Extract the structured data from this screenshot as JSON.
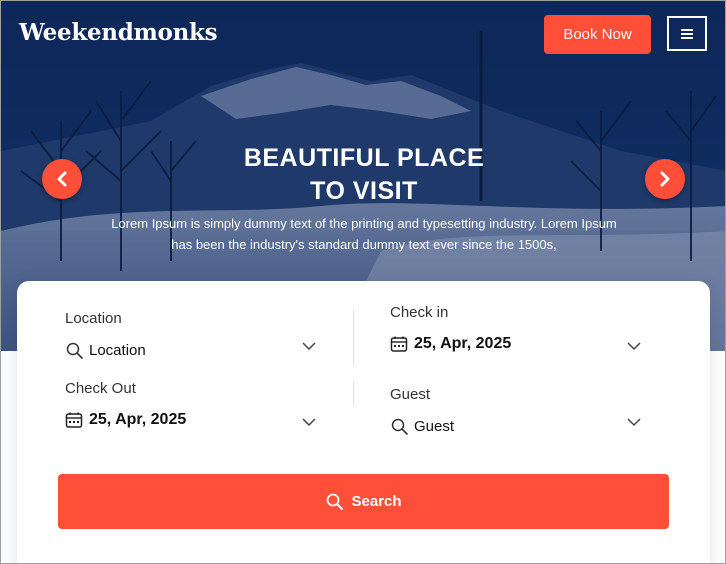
{
  "header": {
    "brand": "Weekendmonks",
    "book_now_label": "Book Now",
    "menu_icon": "hamburger-icon"
  },
  "hero": {
    "title_line1": "BEAUTIFUL PLACE",
    "title_line2": "TO VISIT",
    "description": "Lorem Ipsum is simply dummy text of the printing and typesetting industry. Lorem Ipsum has been the industry's standard dummy text ever since the 1500s,",
    "prev_icon": "chevron-left-icon",
    "next_icon": "chevron-right-icon"
  },
  "booking": {
    "location": {
      "label": "Location",
      "value": "Location",
      "icon": "search-icon"
    },
    "check_in": {
      "label": "Check in",
      "value": "25, Apr, 2025",
      "icon": "calendar-icon"
    },
    "check_out": {
      "label": "Check Out",
      "value": "25, Apr, 2025",
      "icon": "calendar-icon"
    },
    "guest": {
      "label": "Guest",
      "value": "Guest",
      "icon": "search-icon"
    },
    "search_label": "Search"
  },
  "colors": {
    "accent": "#ff4f38",
    "hero_overlay": "#0b2350"
  }
}
